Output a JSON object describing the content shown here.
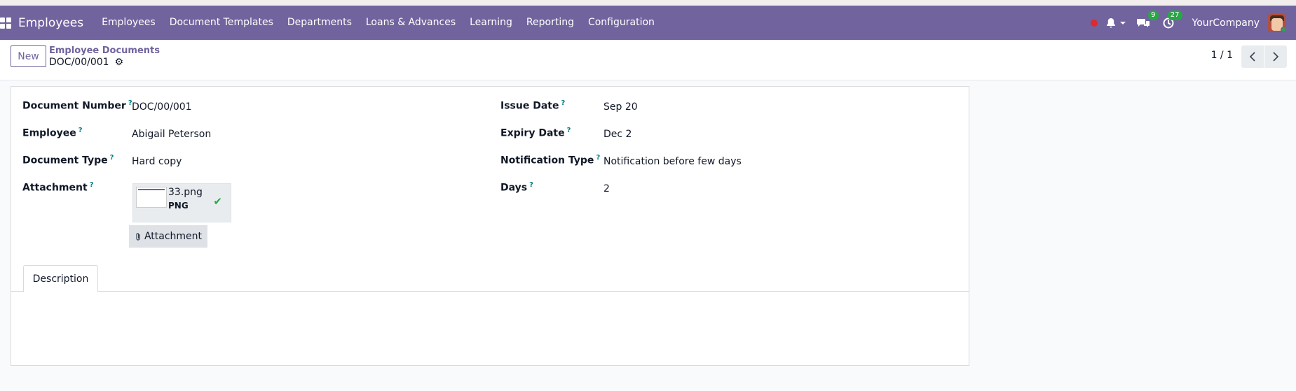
{
  "navbar": {
    "app_name": "Employees",
    "menu": [
      "Employees",
      "Document Templates",
      "Departments",
      "Loans & Advances",
      "Learning",
      "Reporting",
      "Configuration"
    ],
    "messages_count": "9",
    "activities_count": "27",
    "company": "YourCompany",
    "color": "#71639e"
  },
  "control_panel": {
    "new_label": "New",
    "breadcrumb": "Employee Documents",
    "record_name": "DOC/00/001",
    "pager": "1 / 1"
  },
  "form": {
    "document_number": {
      "label": "Document Number",
      "value": "DOC/00/001"
    },
    "employee": {
      "label": "Employee",
      "value": "Abigail Peterson"
    },
    "document_type": {
      "label": "Document Type",
      "value": "Hard copy"
    },
    "attachment": {
      "label": "Attachment",
      "file_name": "33.png",
      "file_type": "PNG",
      "button_label": "Attachment"
    },
    "issue_date": {
      "label": "Issue Date",
      "value": "Sep 20"
    },
    "expiry_date": {
      "label": "Expiry Date",
      "value": "Dec 2"
    },
    "notification_type": {
      "label": "Notification Type",
      "value": "Notification before few days"
    },
    "days": {
      "label": "Days",
      "value": "2"
    },
    "help_marker": "?"
  },
  "tabs": [
    {
      "label": "Description"
    }
  ]
}
